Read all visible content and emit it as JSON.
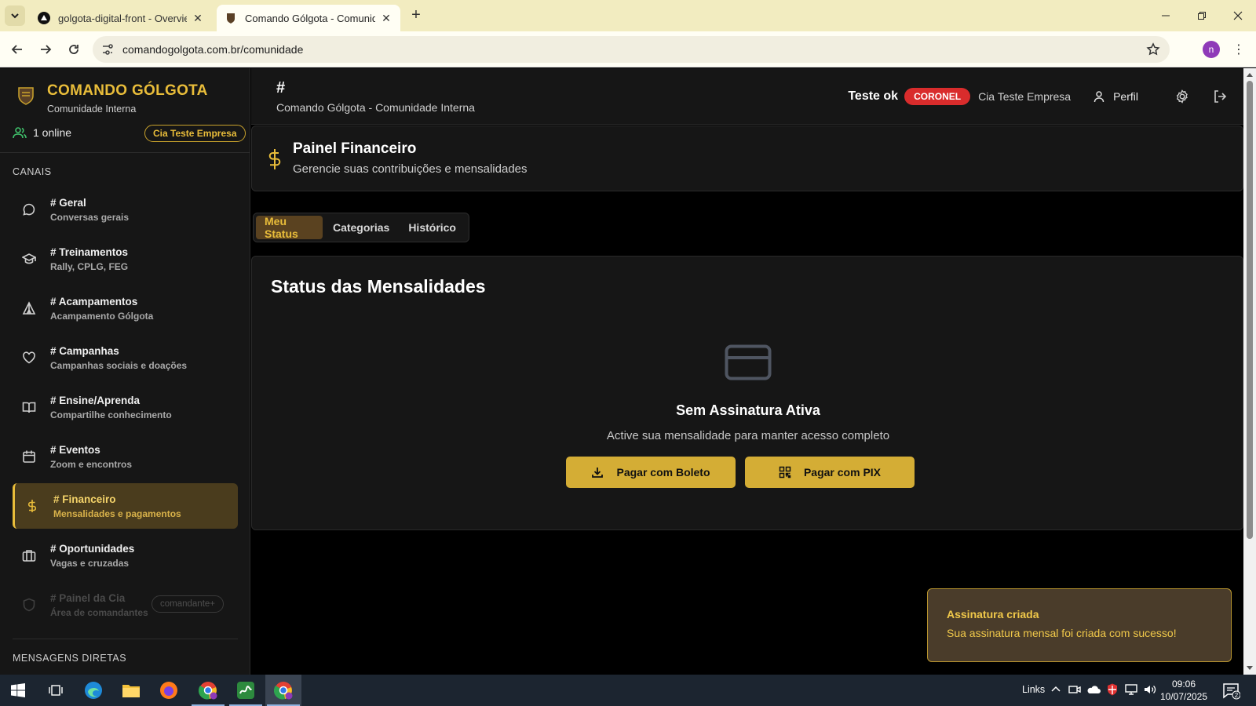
{
  "browser": {
    "tabs": [
      {
        "title": "golgota-digital-front - Overview",
        "active": false
      },
      {
        "title": "Comando Gólgota - Comunidade",
        "active": true
      }
    ],
    "url": "comandogolgota.com.br/comunidade",
    "profile_initial": "n"
  },
  "sidebar": {
    "brand_title": "COMANDO GÓLGOTA",
    "brand_subtitle": "Comunidade Interna",
    "online_text": "1 online",
    "company_badge": "Cia Teste Empresa",
    "channels_label": "CANAIS",
    "channels": [
      {
        "name": "# Geral",
        "desc": "Conversas gerais",
        "icon": "chat-bubble-icon"
      },
      {
        "name": "# Treinamentos",
        "desc": "Rally, CPLG, FEG",
        "icon": "graduation-cap-icon"
      },
      {
        "name": "# Acampamentos",
        "desc": "Acampamento Gólgota",
        "icon": "tent-icon"
      },
      {
        "name": "# Campanhas",
        "desc": "Campanhas sociais e doações",
        "icon": "heart-icon"
      },
      {
        "name": "# Ensine/Aprenda",
        "desc": "Compartilhe conhecimento",
        "icon": "book-icon"
      },
      {
        "name": "# Eventos",
        "desc": "Zoom e encontros",
        "icon": "calendar-icon"
      },
      {
        "name": "# Financeiro",
        "desc": "Mensalidades e pagamentos",
        "icon": "dollar-icon",
        "active": true
      },
      {
        "name": "# Oportunidades",
        "desc": "Vagas e cruzadas",
        "icon": "briefcase-icon"
      },
      {
        "name": "# Painel da Cia",
        "desc": "Área de comandantes",
        "icon": "shield-icon",
        "disabled": true,
        "badge": "comandante+"
      }
    ],
    "dm_label": "MENSAGENS DIRETAS"
  },
  "topbar": {
    "hash": "#",
    "subtitle": "Comando Gólgota - Comunidade Interna",
    "user_name": "Teste ok",
    "rank": "CORONEL",
    "company": "Cia Teste Empresa",
    "profile_label": "Perfil"
  },
  "finance": {
    "title": "Painel Financeiro",
    "subtitle": "Gerencie suas contribuições e mensalidades",
    "tabs": [
      {
        "label": "Meu Status",
        "active": true
      },
      {
        "label": "Categorias",
        "active": false
      },
      {
        "label": "Histórico",
        "active": false
      }
    ],
    "card_title": "Status das Mensalidades",
    "empty_title": "Sem Assinatura Ativa",
    "empty_subtitle": "Active sua mensalidade para manter acesso completo",
    "boleto_button": "Pagar com Boleto",
    "pix_button": "Pagar com PIX"
  },
  "toast": {
    "title": "Assinatura criada",
    "message": "Sua assinatura mensal foi criada com sucesso!"
  },
  "taskbar": {
    "links_label": "Links",
    "time": "09:06",
    "date": "10/07/2025",
    "notification_count": "2"
  },
  "colors": {
    "accent": "#e9bd3a",
    "rank_badge": "#d92c2c",
    "sidebar_bg": "#161616"
  }
}
